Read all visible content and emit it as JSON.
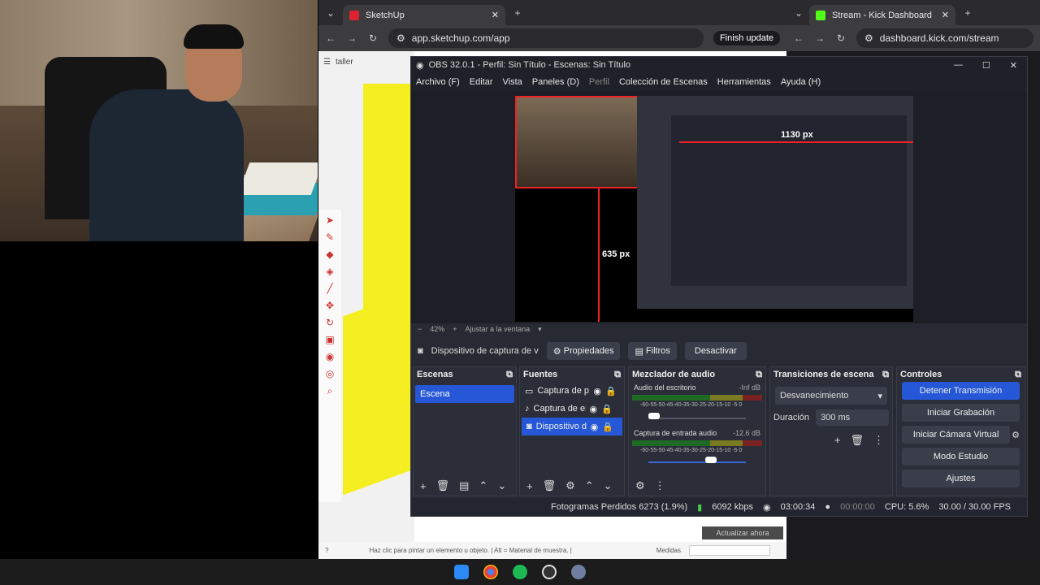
{
  "sketchup_window": {
    "tab_title": "SketchUp",
    "url": "app.sketchup.com/app",
    "finish_update": "Finish update",
    "toolbar_label": "taller",
    "update_btn": "Actualizar ahora",
    "status_hint": "Haz clic para pintar un elemento u objeto. | Alt = Material de muestra. |",
    "measures_label": "Medidas"
  },
  "kick_window": {
    "tab_title": "Stream - Kick Dashboard",
    "url": "dashboard.kick.com/stream"
  },
  "obs": {
    "title": "OBS 32.0.1 - Perfil: Sin Título - Escenas: Sin Título",
    "menu": [
      "Archivo (F)",
      "Editar",
      "Vista",
      "Paneles (D)",
      "Perfil",
      "Colección de Escenas",
      "Herramientas",
      "Ayuda (H)"
    ],
    "zoom_level": "42%",
    "fit_label": "Ajustar a la ventana",
    "preview_labels": {
      "width": "1130 px",
      "height": "635 px"
    },
    "source_bar": {
      "name": "Dispositivo de captura de v",
      "props": "Propiedades",
      "filters": "Filtros",
      "deactivate": "Desactivar"
    },
    "scenes": {
      "title": "Escenas",
      "items": [
        "Escena"
      ]
    },
    "sources": {
      "title": "Fuentes",
      "items": [
        "Captura de pa",
        "Captura de er",
        "Dispositivo de"
      ]
    },
    "mixer": {
      "title": "Mezclador de audio",
      "channels": [
        {
          "name": "Audio del escritorio",
          "db": "-Inf dB"
        },
        {
          "name": "Captura de entrada audio",
          "db": "-12.6 dB"
        }
      ],
      "scale": "-60-55-50-45-40-35-30-25-20-15-10 -5 0"
    },
    "transitions": {
      "title": "Transiciones de escena",
      "type": "Desvanecimiento",
      "duration_label": "Duración",
      "duration": "300 ms"
    },
    "controls": {
      "title": "Controles",
      "buttons": [
        "Detener Transmisión",
        "Iniciar Grabación",
        "Iniciar Cámara Virtual",
        "Modo Estudio",
        "Ajustes"
      ]
    },
    "status": {
      "dropped": "Fotogramas Perdidos 6273 (1.9%)",
      "bitrate": "6092 kbps",
      "stream_time": "03:00:34",
      "rec_time": "00:00:00",
      "cpu": "CPU: 5.6%",
      "fps": "30.00 / 30.00 FPS"
    }
  },
  "colors": {
    "accent": "#2557d6",
    "obs_bg": "#272a33",
    "sketch_yellow": "#f5ef22"
  }
}
